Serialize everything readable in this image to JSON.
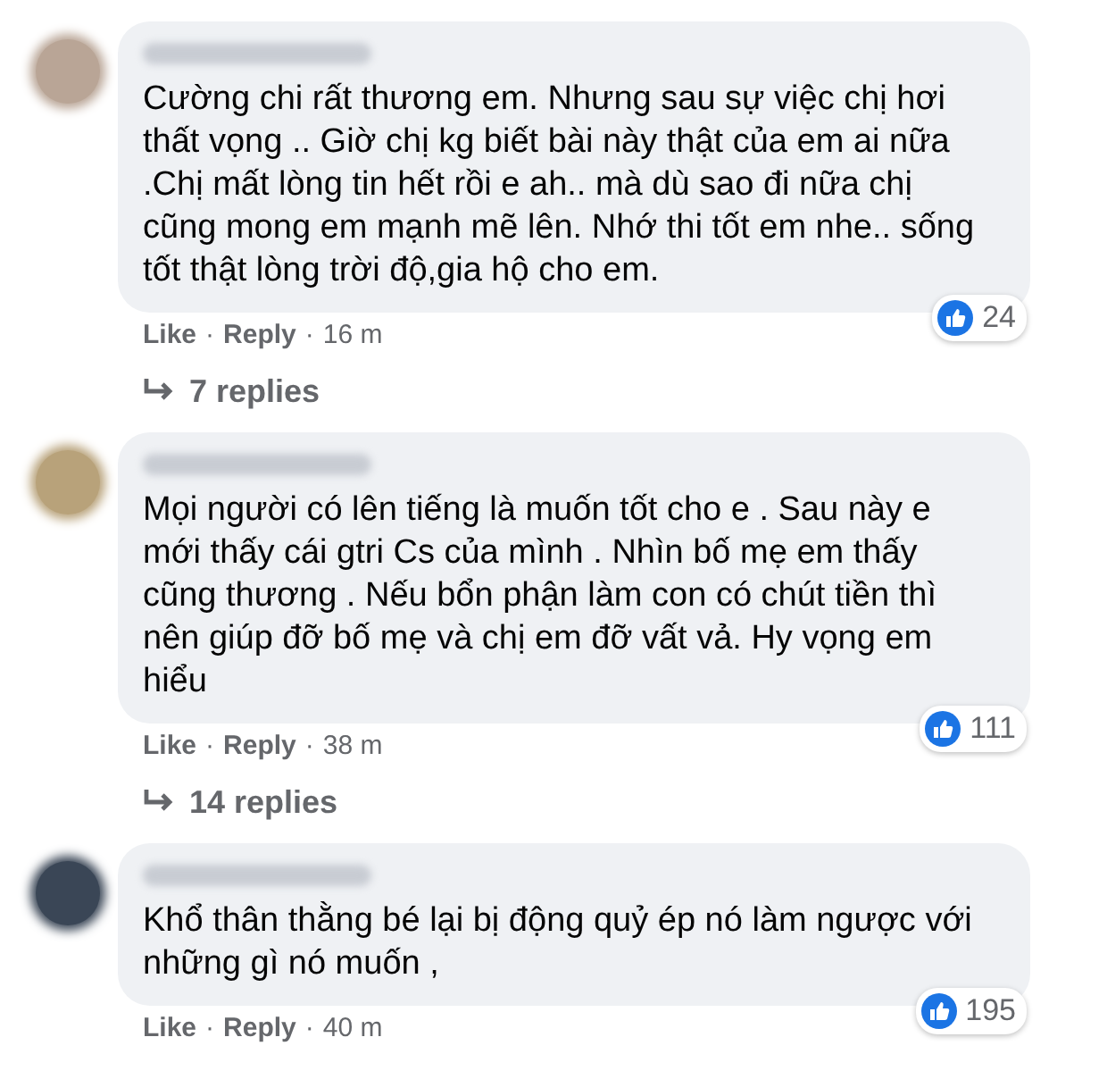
{
  "comments": [
    {
      "color": "#b9a596",
      "text": "Cường chi rất thương em. Nhưng sau sự việc chị hơi thất vọng .. Giờ chị kg biết bài này thật của em ai nữa .Chị mất lòng tin hết rồi e ah.. mà dù sao đi nữa chị cũng mong em mạnh mẽ lên. Nhớ thi tốt em nhe.. sống tốt thật lòng trời độ,gia hộ cho em.",
      "likes": "24",
      "footer": [
        {
          "kind": "action",
          "text": "Like"
        },
        {
          "kind": "dot",
          "text": "·"
        },
        {
          "kind": "action",
          "text": "Reply"
        },
        {
          "kind": "dot",
          "text": "·"
        },
        {
          "kind": "time",
          "text": "16 m"
        }
      ],
      "replies": "7 replies"
    },
    {
      "color": "#b8a27a",
      "text": "Mọi người có lên tiếng là muốn tốt cho e . Sau này e mới thấy cái gtri Cs của mình . Nhìn bố mẹ em thấy cũng thương . Nếu bổn phận làm con có chút tiền thì nên giúp đỡ bố mẹ và chị em đỡ vất vả. Hy vọng em hiểu",
      "likes": "111",
      "footer": [
        {
          "kind": "action",
          "text": "Like"
        },
        {
          "kind": "dot",
          "text": "·"
        },
        {
          "kind": "action",
          "text": "Reply"
        },
        {
          "kind": "dot",
          "text": "·"
        },
        {
          "kind": "time",
          "text": "38 m"
        }
      ],
      "replies": "14 replies"
    },
    {
      "color": "#3a4656",
      "text": "Khổ thân thằng bé lại bị động quỷ ép nó làm ngược với những gì nó muốn ,",
      "likes": "195",
      "footer": [
        {
          "kind": "action",
          "text": "Like"
        },
        {
          "kind": "dot",
          "text": "·"
        },
        {
          "kind": "action",
          "text": "Reply"
        },
        {
          "kind": "dot",
          "text": "·"
        },
        {
          "kind": "time",
          "text": "40 m"
        }
      ]
    }
  ]
}
